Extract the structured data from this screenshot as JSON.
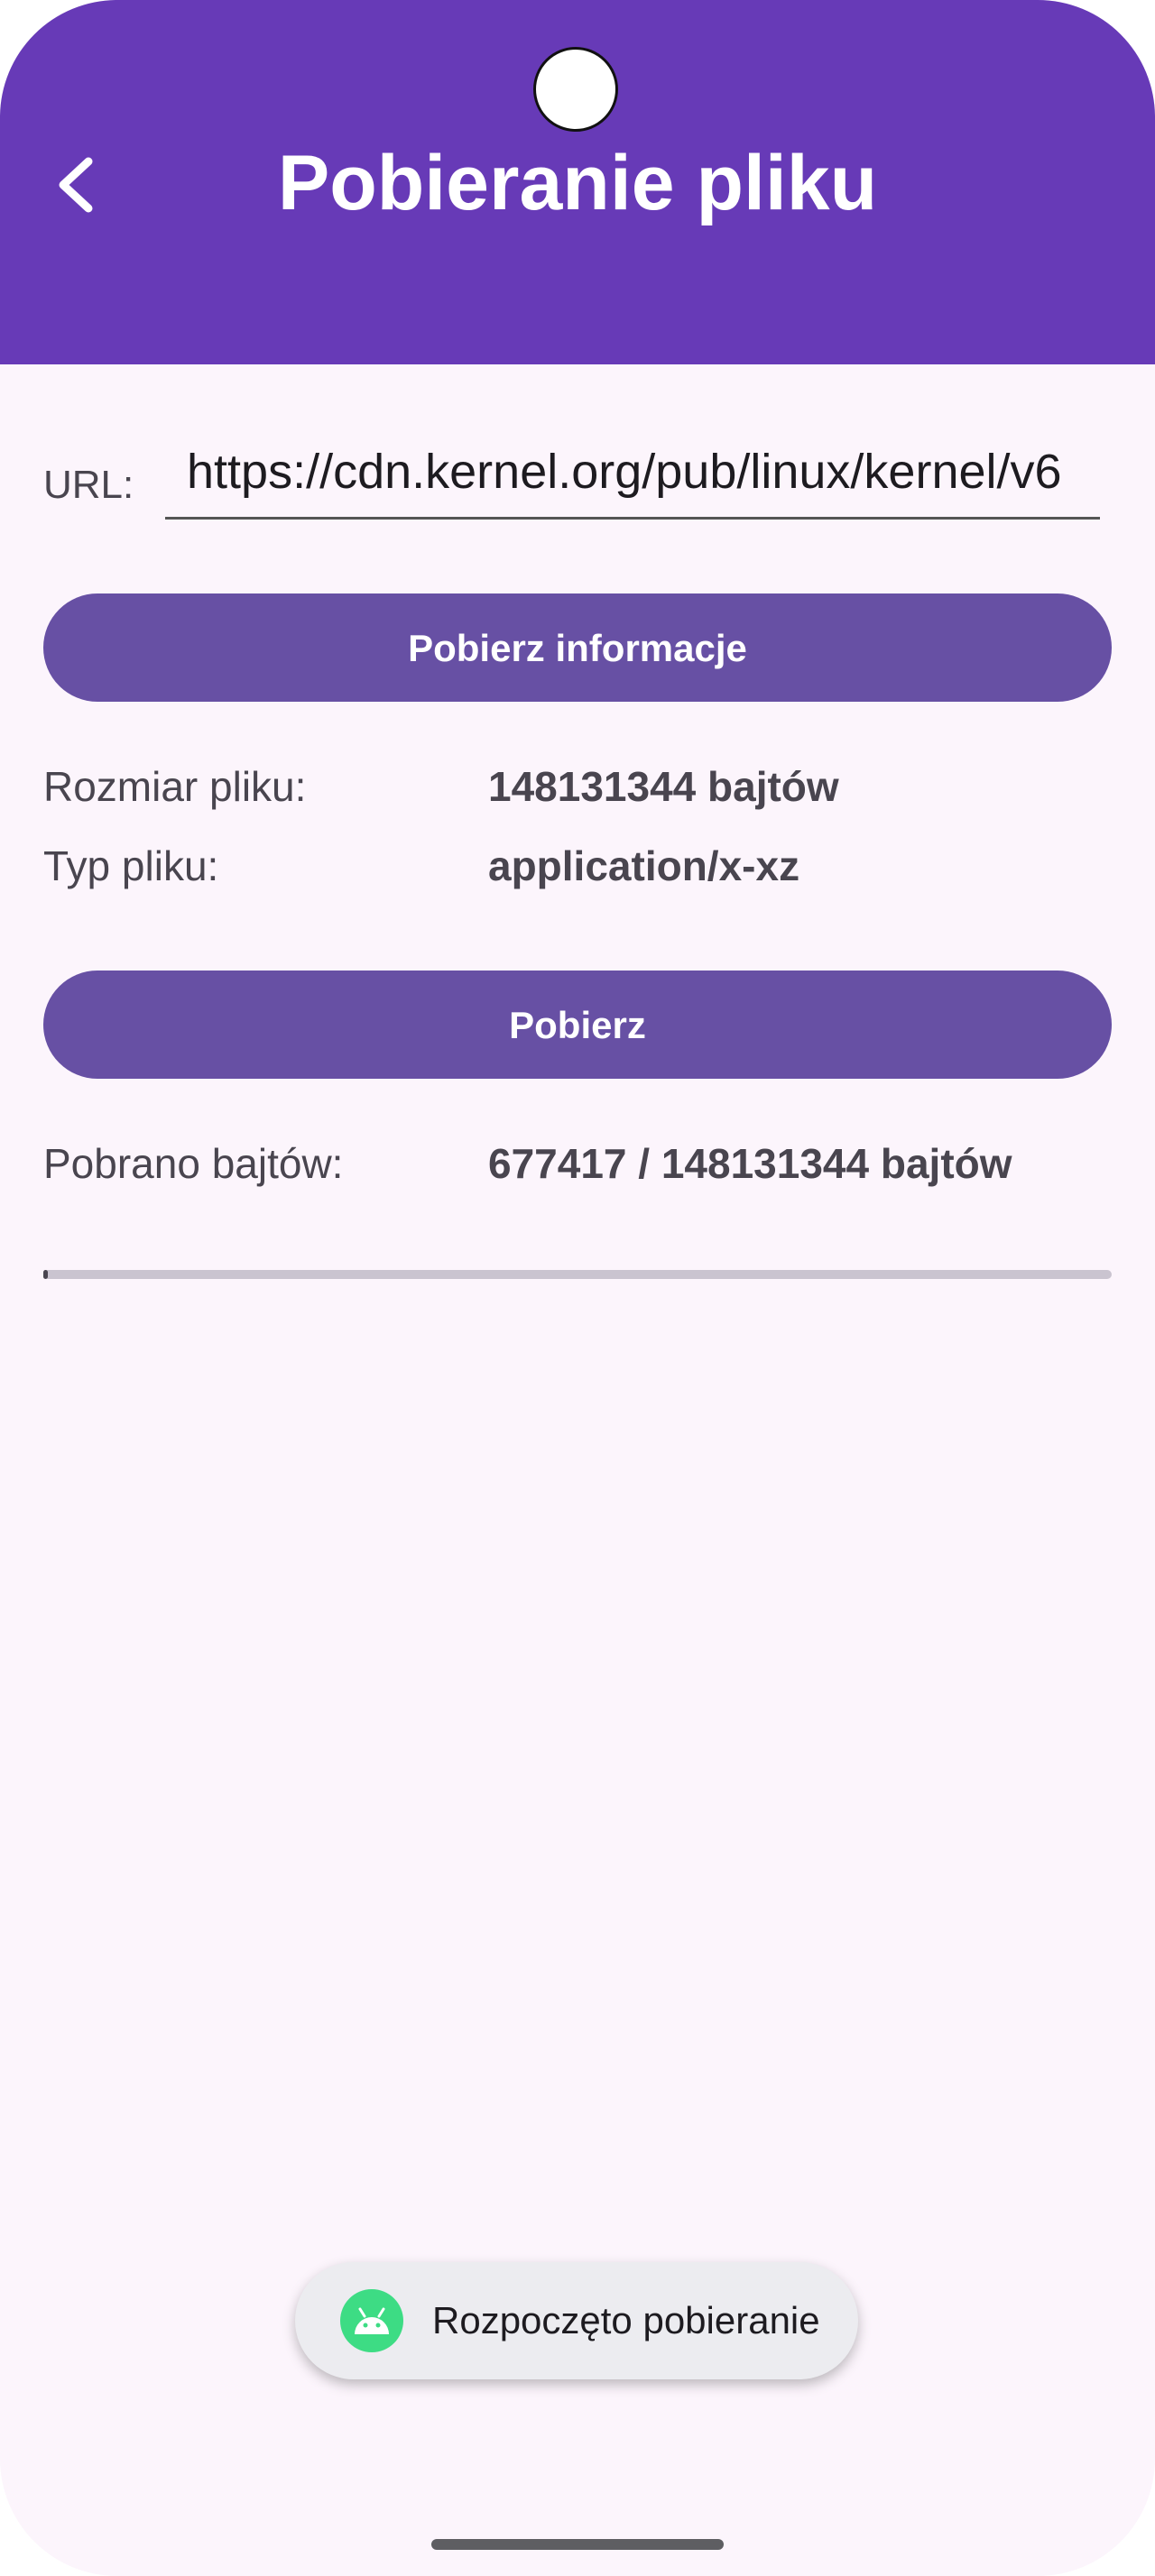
{
  "app_bar": {
    "title": "Pobieranie pliku",
    "color": "#673ab7"
  },
  "url_field": {
    "label": "URL:",
    "value": "https://cdn.kernel.org/pub/linux/kernel/v6"
  },
  "info_button": {
    "label": "Pobierz informacje"
  },
  "file_info": {
    "size_label": "Rozmiar pliku:",
    "size_value": "148131344 bajtów",
    "type_label": "Typ pliku:",
    "type_value": "application/x-xz"
  },
  "download_button": {
    "label": "Pobierz"
  },
  "progress": {
    "label": "Pobrano bajtów:",
    "value_text": "677417 / 148131344 bajtów",
    "downloaded": 677417,
    "total": 148131344
  },
  "toast": {
    "icon": "android-icon",
    "text": "Rozpoczęto pobieranie"
  },
  "accent_color": "#6750a4"
}
